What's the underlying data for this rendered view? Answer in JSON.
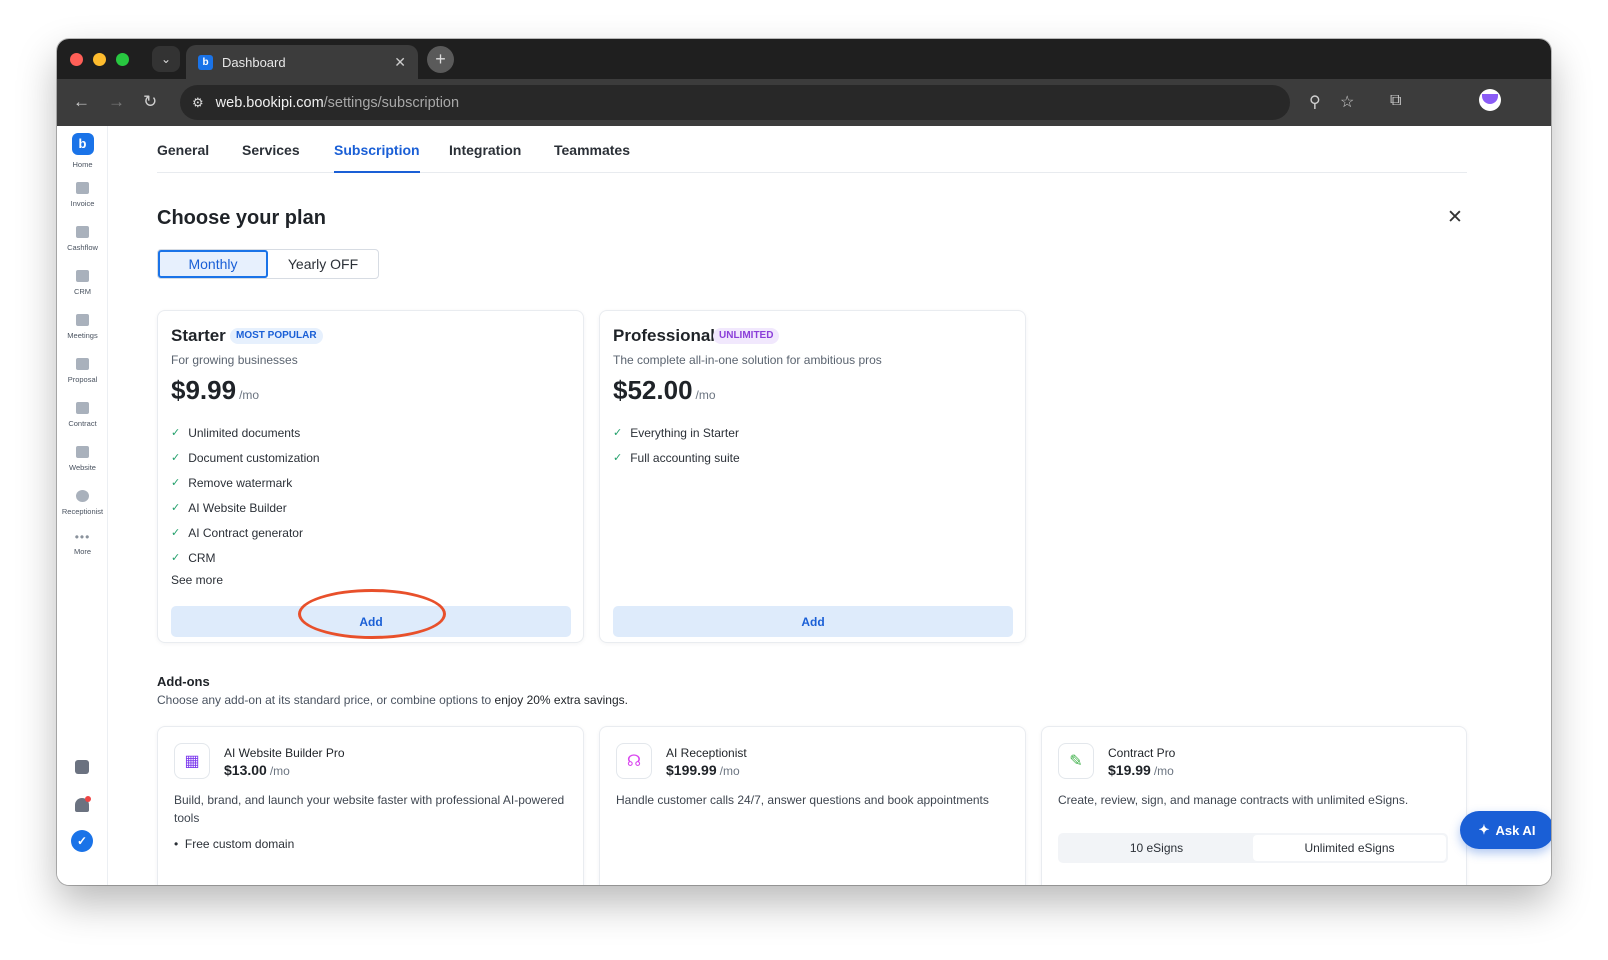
{
  "browser": {
    "tab_title": "Dashboard",
    "url_host": "web.bookipi.com",
    "url_path": "/settings/subscription",
    "controls": {
      "close": "#ff5f57",
      "minimize": "#febc2e",
      "maximize": "#28c840"
    }
  },
  "sidebar": {
    "items": [
      {
        "label": "Home",
        "icon": "bookipi-logo-icon"
      },
      {
        "label": "Invoice",
        "icon": "invoice-icon"
      },
      {
        "label": "Cashflow",
        "icon": "cashflow-icon"
      },
      {
        "label": "CRM",
        "icon": "crm-icon"
      },
      {
        "label": "Meetings",
        "icon": "meetings-icon"
      },
      {
        "label": "Proposal",
        "icon": "proposal-icon"
      },
      {
        "label": "Contract",
        "icon": "contract-icon"
      },
      {
        "label": "Website",
        "icon": "website-icon"
      },
      {
        "label": "Receptionist",
        "icon": "receptionist-icon"
      },
      {
        "label": "More",
        "icon": "more-icon"
      }
    ]
  },
  "subnav": {
    "tabs": [
      "General",
      "Services",
      "Subscription",
      "Integration",
      "Teammates"
    ],
    "active": "Subscription"
  },
  "page": {
    "title": "Choose your plan",
    "billing_toggle": {
      "monthly": "Monthly",
      "yearly": "Yearly OFF",
      "selected": "Monthly"
    }
  },
  "plans": [
    {
      "name": "Starter",
      "badge": "MOST POPULAR",
      "description": "For growing businesses",
      "price": "$9.99",
      "period": "/mo",
      "features": [
        "Unlimited documents",
        "Document customization",
        "Remove watermark",
        "AI Website Builder",
        "AI Contract generator",
        "CRM"
      ],
      "see_more": "See more",
      "button": "Add"
    },
    {
      "name": "Professional",
      "badge": "UNLIMITED",
      "description": "The complete all-in-one solution for ambitious pros",
      "price": "$52.00",
      "period": "/mo",
      "features": [
        "Everything in Starter",
        "Full accounting suite"
      ],
      "button": "Add"
    }
  ],
  "addons": {
    "title": "Add-ons",
    "description": "Choose any add-on at its standard price, or combine options to",
    "description_highlight": "enjoy 20% extra savings.",
    "items": [
      {
        "title": "AI Website Builder Pro",
        "price": "$13.00",
        "period": "/mo",
        "description": "Build, brand, and launch your website faster with professional AI-powered tools",
        "bullet": "Free custom domain",
        "icon": "website-builder-icon"
      },
      {
        "title": "AI Receptionist",
        "price": "$199.99",
        "period": "/mo",
        "description": "Handle customer calls 24/7, answer questions and book appointments",
        "icon": "headset-icon"
      },
      {
        "title": "Contract Pro",
        "price": "$19.99",
        "period": "/mo",
        "description": "Create, review, sign, and manage contracts with unlimited eSigns.",
        "options": [
          "10 eSigns",
          "Unlimited eSigns"
        ],
        "selected_option": "Unlimited eSigns",
        "icon": "contract-pro-icon"
      }
    ]
  },
  "ask_ai": {
    "label": "Ask AI"
  },
  "colors": {
    "accent": "#1a5fd6",
    "annotation_ring": "#e8502b",
    "check": "#22a06b"
  }
}
